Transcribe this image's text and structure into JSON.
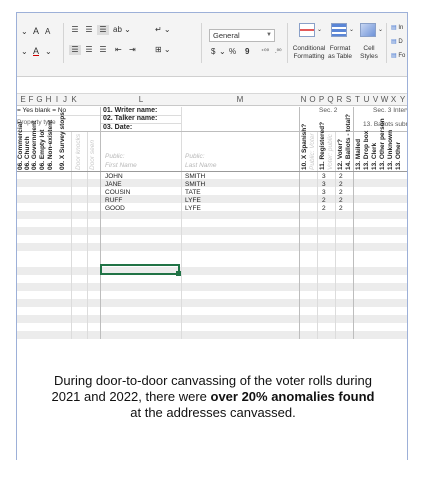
{
  "ribbon": {
    "font_size_up": "A",
    "font_size_down": "A",
    "font_color_label": "A",
    "number_format": "General",
    "currency_symbol": "$",
    "percent_symbol": "%",
    "comma_symbol": "9",
    "conditional_formatting": "Conditional\nFormatting",
    "format_as_table": "Format\nas Table",
    "cell_styles": "Cell\nStyles",
    "side_labels": [
      "In",
      "D",
      "Fo"
    ]
  },
  "columns": [
    "E",
    "F",
    "G",
    "H",
    "I",
    "J",
    "K",
    "L",
    "M",
    "N",
    "O",
    "P",
    "Q",
    "R",
    "S",
    "T",
    "U",
    "V",
    "W",
    "X",
    "Y"
  ],
  "header_rows": {
    "legend": "= Yes  blank = No",
    "property_type": "Property type",
    "writer": "01. Writer name:",
    "talker": "02. Talker name:",
    "date": "03. Date:",
    "sec2": "Sec. 2",
    "sec3": "Sec. 3  Interv",
    "ballots_submitted": "13. Ballots submitted?"
  },
  "vertical_headers": {
    "left": [
      "06. Commercial",
      "06. Church",
      "06. Government",
      "06. Empty lot",
      "06. Non-existent",
      "09. X  Survey stops",
      "Door knocks",
      "Door seen"
    ],
    "right": [
      "10. X  Spanish?",
      "Public: Voter",
      "11. Registered?",
      "Voter: public",
      "12. Voter?",
      "14. Ballots - total?",
      "13. Mailed",
      "13. Drop box",
      "13. Clerk",
      "13. Other person",
      "13. Unknown",
      "13. Other"
    ]
  },
  "name_headers": {
    "first_public": "Public:",
    "first_label": "First Name",
    "last_public": "Public:",
    "last_label": "Last Name"
  },
  "rows": [
    {
      "first": "JOHN",
      "last": "SMITH",
      "p": "3",
      "q": "2"
    },
    {
      "first": "JANE",
      "last": "SMITH",
      "p": "3",
      "q": "2"
    },
    {
      "first": "COUSIN",
      "last": "TATE",
      "p": "3",
      "q": "2"
    },
    {
      "first": "RUFF",
      "last": "LYFE",
      "p": "2",
      "q": "2"
    },
    {
      "first": "GOOD",
      "last": "LYFE",
      "p": "2",
      "q": "2"
    }
  ],
  "caption": {
    "part1": "During door-to-door canvassing of the voter rolls  during 2021 and 2022, there were ",
    "bold": "over 20% anomalies  found",
    "part2": " at the addresses canvassed."
  },
  "colors": {
    "accent": "#217346",
    "ribbon_bg": "#f4f4f4",
    "band": "#ececec",
    "frame": "#9db0d8"
  }
}
